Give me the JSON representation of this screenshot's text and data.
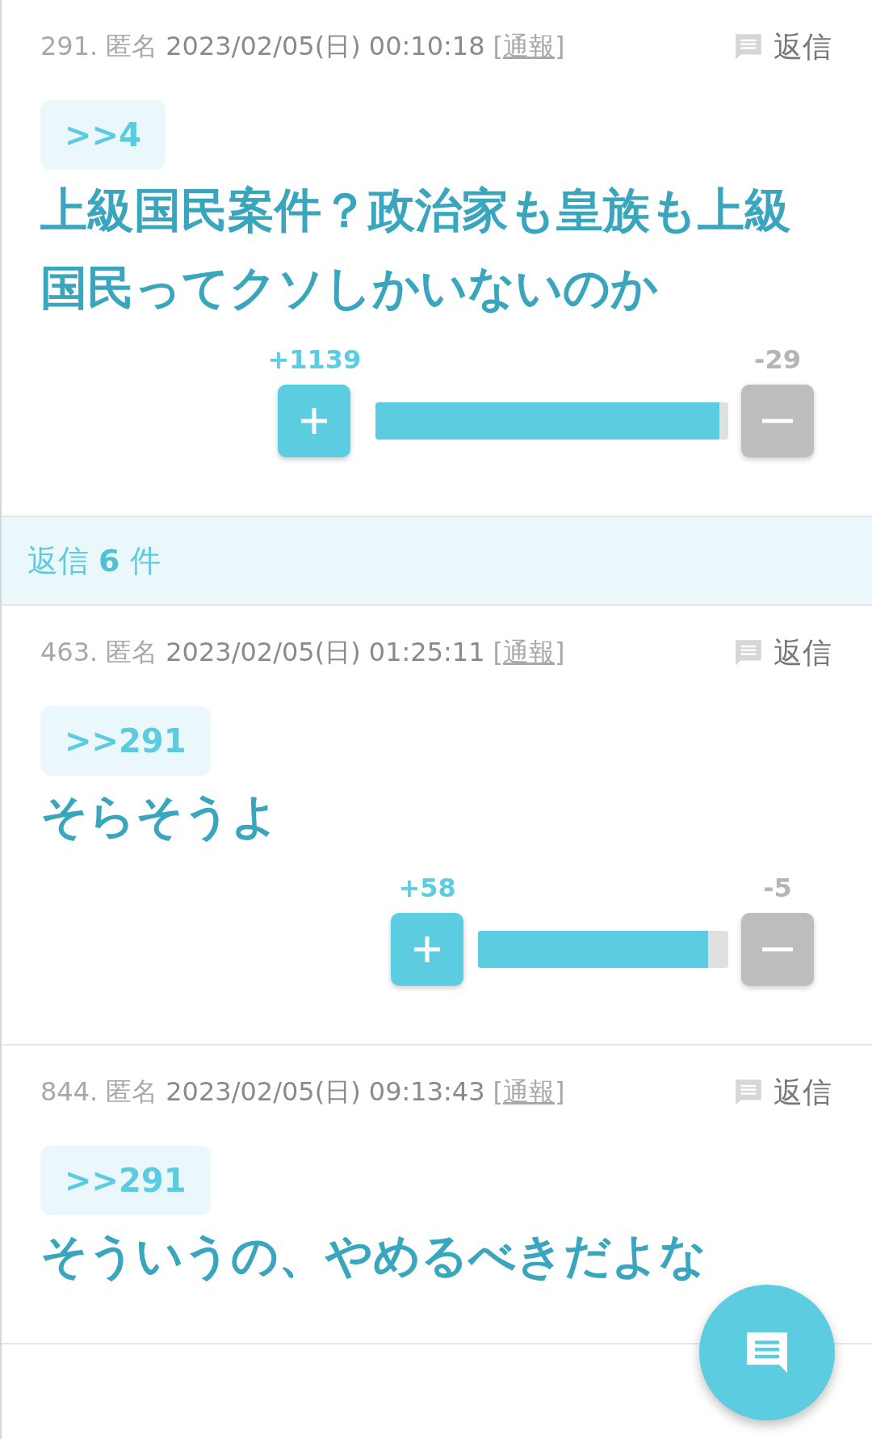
{
  "parent": {
    "number": "291.",
    "name": "匿名",
    "date": "2023/02/05(日) 00:10:18",
    "report": "[通報]",
    "reply": "返信",
    "quote": ">>4",
    "body": "上級国民案件？政治家も皇族も上級国民ってクソしかいないのか",
    "votes": {
      "up": "+1139",
      "down": "-29",
      "level": 0.975
    }
  },
  "replies_header": {
    "label": "返信 **6** 件"
  },
  "replies": [
    {
      "number": "463.",
      "name": "匿名",
      "date": "2023/02/05(日) 01:25:11",
      "report": "[通報]",
      "reply": "返信",
      "quote": ">>291",
      "body": "そらそうよ",
      "votes": {
        "up": "+58",
        "down": "-5",
        "level": 0.92
      }
    },
    {
      "number": "844.",
      "name": "匿名",
      "date": "2023/02/05(日) 09:13:43",
      "report": "[通報]",
      "reply": "返信",
      "quote": ">>291",
      "body": "そういうの、やめるべきだよな"
    }
  ]
}
